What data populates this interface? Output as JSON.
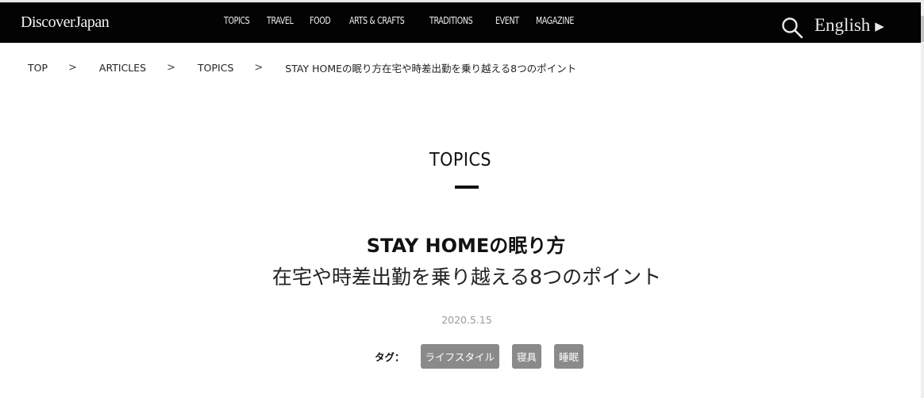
{
  "header": {
    "logo": "DiscoverJapan",
    "nav": [
      "TOPICS",
      "TRAVEL",
      "FOOD",
      "ARTS & CRAFTS",
      "TRADITIONS",
      "EVENT",
      "MAGAZINE"
    ],
    "search_icon": "search-icon",
    "language_label": "English",
    "language_arrow": "▶"
  },
  "breadcrumb": {
    "items": [
      "TOP",
      "ARTICLES",
      "TOPICS",
      "STAY HOMEの眠り方在宅や時差出勤を乗り越える8つのポイント"
    ],
    "separator": ">"
  },
  "article": {
    "category": "TOPICS",
    "title": "STAY HOMEの眠り方",
    "subtitle": "在宅や時差出勤を乗り越える8つのポイント",
    "date": "2020.5.15",
    "tags_label": "タグ：",
    "tags": [
      "ライフスタイル",
      "寝具",
      "睡眠"
    ]
  },
  "colors": {
    "header_bg": "#030303",
    "tag_bg": "#8a8a8a",
    "date_text": "#999999"
  }
}
